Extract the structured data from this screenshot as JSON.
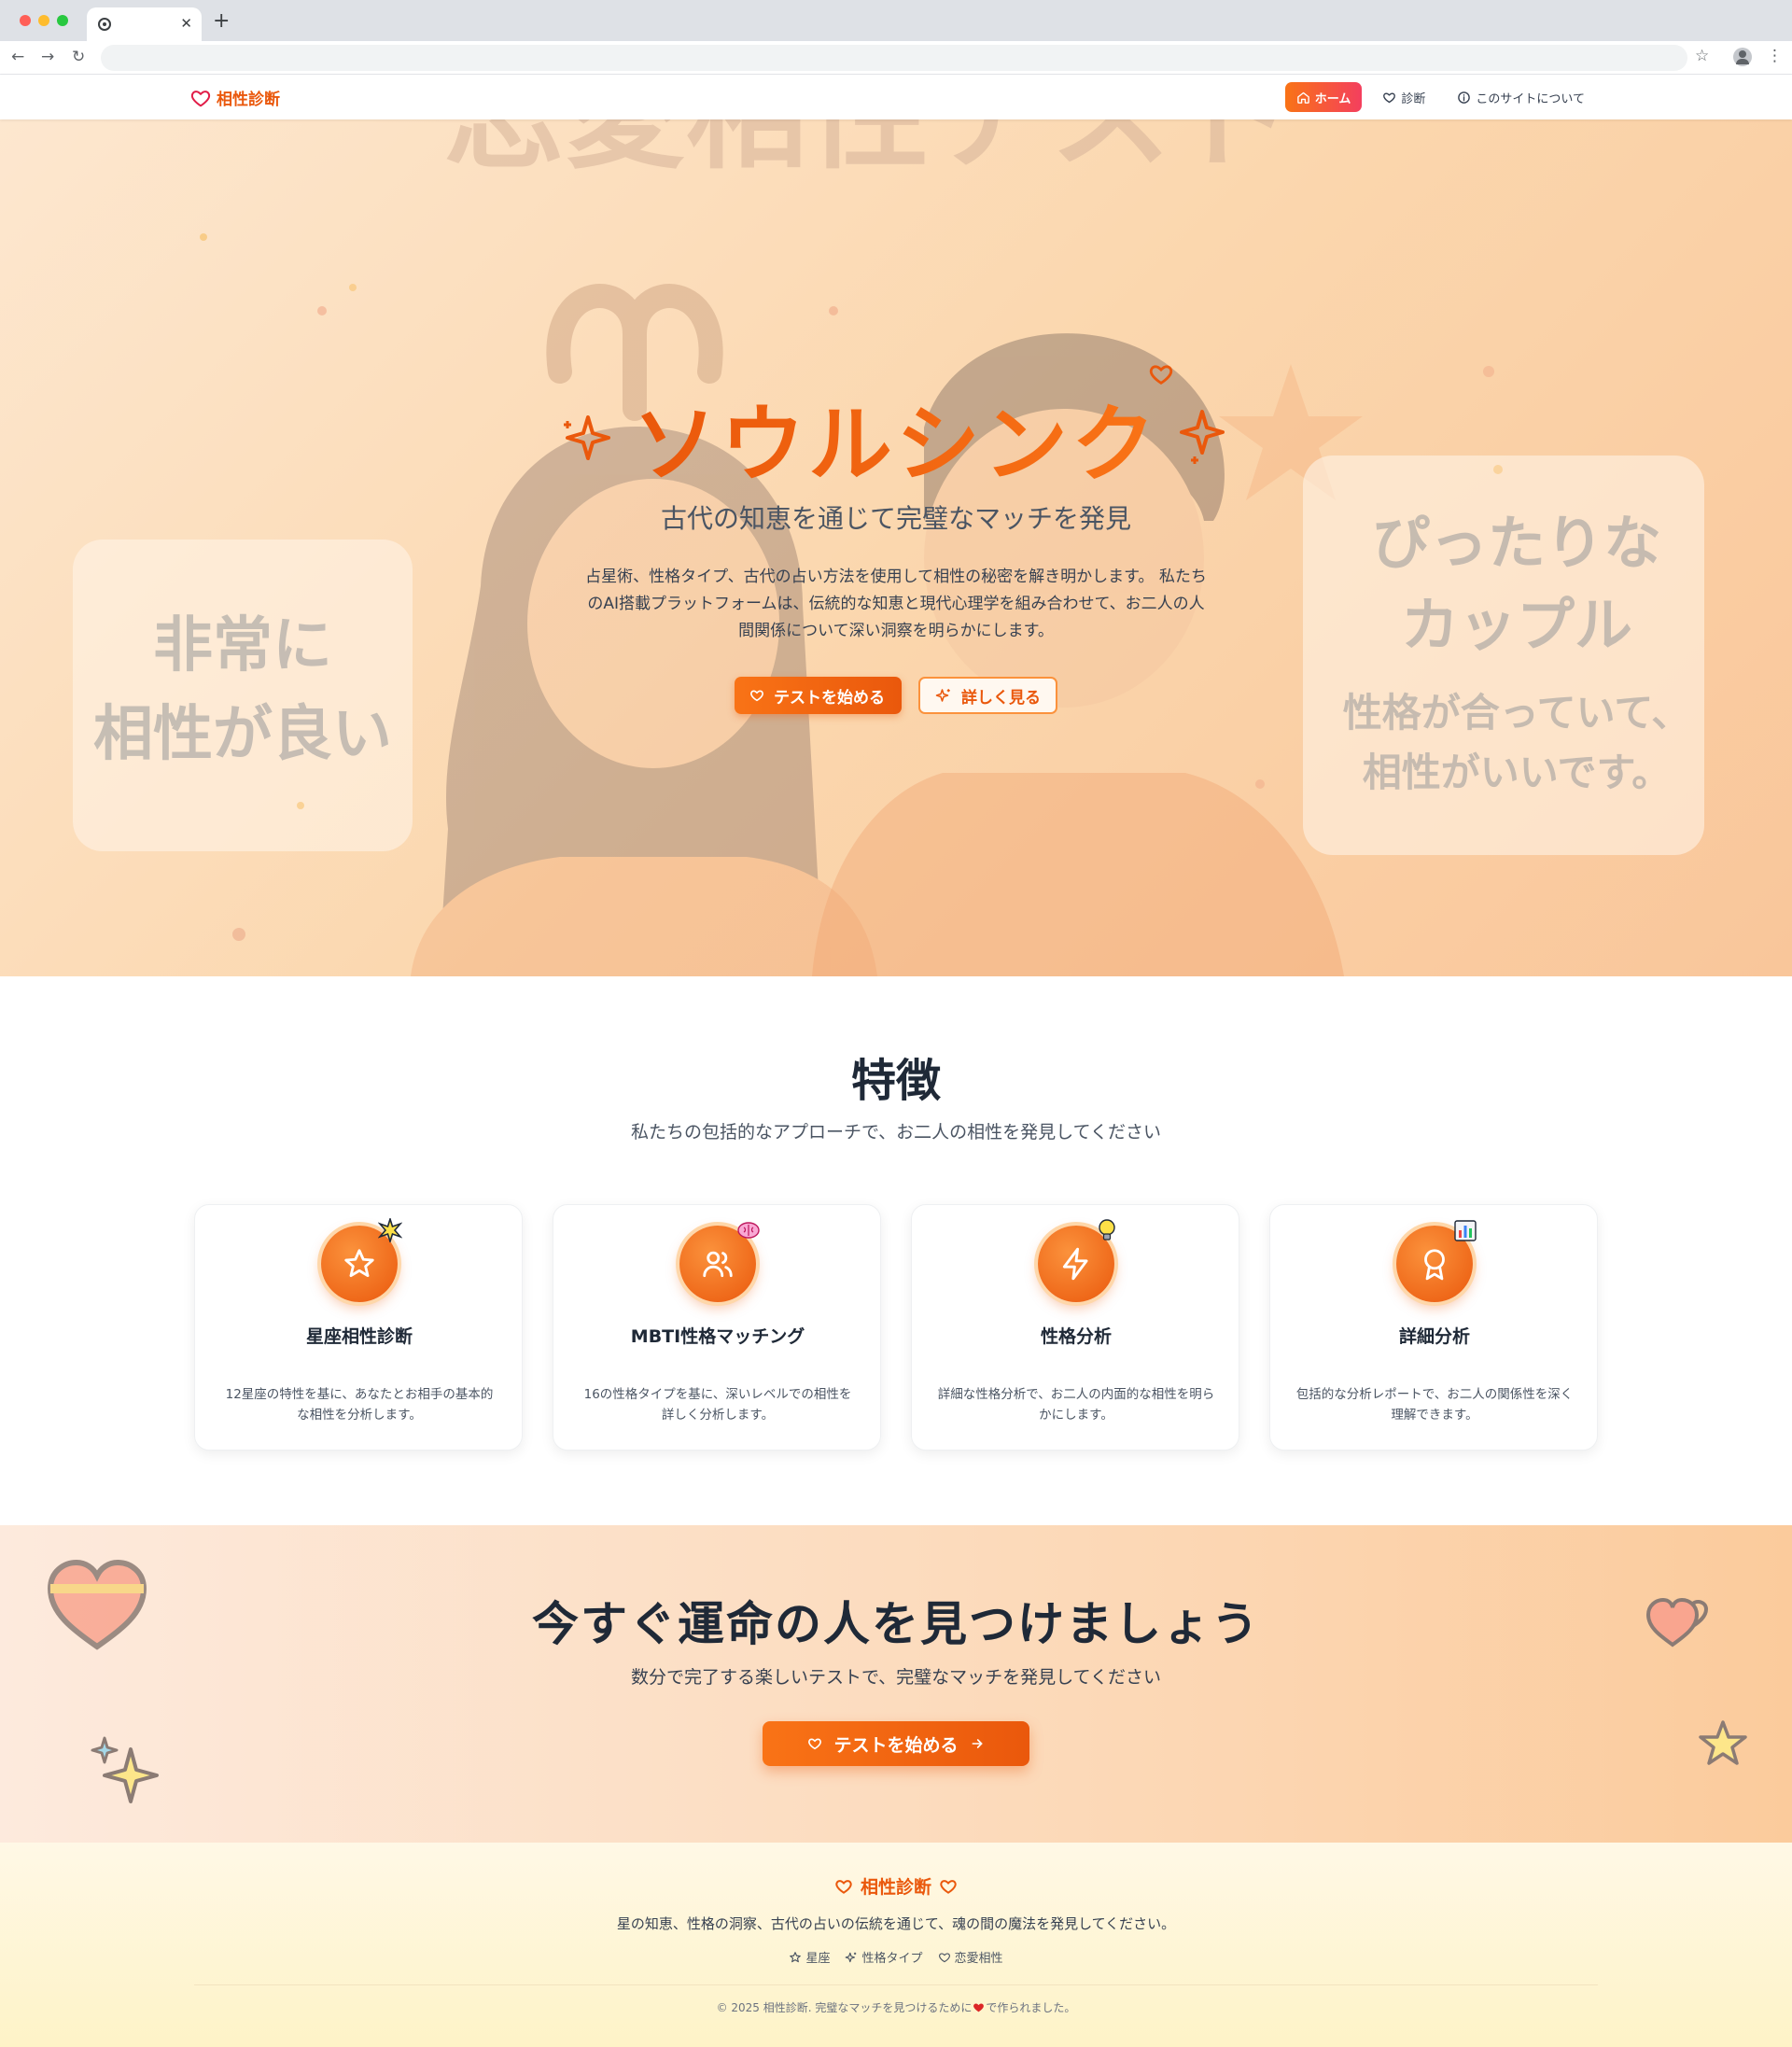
{
  "site": {
    "logo": "相性診断",
    "nav": [
      {
        "label": "ホーム",
        "icon": "home-icon"
      },
      {
        "label": "診断",
        "icon": "heart-icon"
      },
      {
        "label": "このサイトについて",
        "icon": "info-icon"
      }
    ]
  },
  "hero": {
    "title": "ソウルシンク",
    "subtitle": "古代の知恵を通じて完璧なマッチを発見",
    "description": "占星術、性格タイプ、古代の占い方法を使用して相性の秘密を解き明かします。 私たちのAI搭載プラットフォームは、伝統的な知恵と現代心理学を組み合わせて、お二人の人間関係について深い洞察を明らかにします。",
    "start_button": "テストを始める",
    "more_button": "詳しく見る",
    "bg_banner_text": "恋愛相性テスト",
    "bg_left_card": [
      "非常に",
      "相性が良い"
    ],
    "bg_right_card": [
      "ぴったりな",
      "カップル",
      "性格が合っていて、",
      "相性がいいです。"
    ]
  },
  "features": {
    "title": "特徴",
    "subtitle": "私たちの包括的なアプローチで、お二人の相性を発見してください",
    "cards": [
      {
        "title": "星座相性診断",
        "desc": "12星座の特性を基に、あなたとお相手の基本的な相性を分析します。",
        "icon": "star-icon",
        "emoji": "sparkle-emoji"
      },
      {
        "title": "MBTI性格マッチング",
        "desc": "16の性格タイプを基に、深いレベルでの相性を詳しく分析します。",
        "icon": "users-icon",
        "emoji": "brain-emoji"
      },
      {
        "title": "性格分析",
        "desc": "詳細な性格分析で、お二人の内面的な相性を明らかにします。",
        "icon": "lightning-icon",
        "emoji": "lightbulb-emoji"
      },
      {
        "title": "詳細分析",
        "desc": "包括的な分析レポートで、お二人の関係性を深く理解できます。",
        "icon": "award-icon",
        "emoji": "chart-emoji"
      }
    ]
  },
  "cta": {
    "title": "今すぐ運命の人を見つけましょう",
    "subtitle": "数分で完了する楽しいテストで、完璧なマッチを発見してください",
    "button": "テストを始める"
  },
  "footer": {
    "logo": "相性診断",
    "tagline": "星の知恵、性格の洞察、古代の占いの伝統を通じて、魂の間の魔法を発見してください。",
    "links": [
      {
        "label": "星座",
        "icon": "star-icon"
      },
      {
        "label": "性格タイプ",
        "icon": "sparkles-icon"
      },
      {
        "label": "恋愛相性",
        "icon": "heart-icon"
      }
    ],
    "copyright_pre": "© 2025 相性診断. 完璧なマッチを見つけるために",
    "copyright_post": "で作られました。"
  },
  "colors": {
    "accent": "#ea580c",
    "accent_light": "#f97316",
    "rose": "#f43f5e",
    "hero_bg": "#fbd7ae",
    "footer_bg": "#fef3c7"
  }
}
